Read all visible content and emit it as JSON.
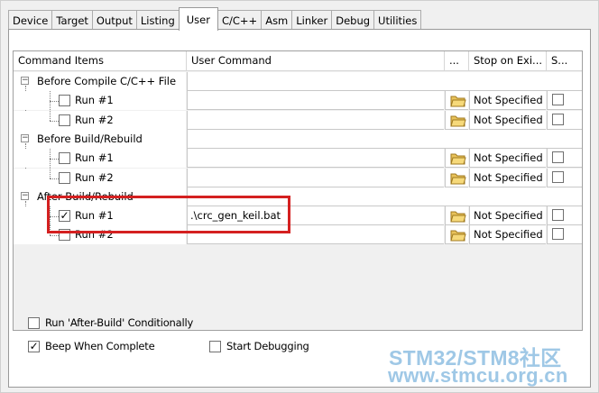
{
  "tabs": [
    {
      "label": "Device"
    },
    {
      "label": "Target"
    },
    {
      "label": "Output"
    },
    {
      "label": "Listing"
    },
    {
      "label": "User",
      "active": true
    },
    {
      "label": "C/C++"
    },
    {
      "label": "Asm"
    },
    {
      "label": "Linker"
    },
    {
      "label": "Debug"
    },
    {
      "label": "Utilities"
    }
  ],
  "grid": {
    "headers": {
      "items": "Command Items",
      "command": "User Command",
      "browse": "...",
      "stop": "Stop on Exi...",
      "s": "S..."
    },
    "groups": [
      {
        "label": "Before Compile C/C++ File",
        "expander": "−",
        "runs": [
          {
            "label": "Run #1",
            "checked": false,
            "command": "",
            "stop": "Not Specified"
          },
          {
            "label": "Run #2",
            "checked": false,
            "command": "",
            "stop": "Not Specified"
          }
        ]
      },
      {
        "label": "Before Build/Rebuild",
        "expander": "−",
        "runs": [
          {
            "label": "Run #1",
            "checked": false,
            "command": "",
            "stop": "Not Specified"
          },
          {
            "label": "Run #2",
            "checked": false,
            "command": "",
            "stop": "Not Specified"
          }
        ]
      },
      {
        "label": "After Build/Rebuild",
        "expander": "−",
        "runs": [
          {
            "label": "Run #1",
            "checked": true,
            "command": ".\\crc_gen_keil.bat",
            "stop": "Not Specified"
          },
          {
            "label": "Run #2",
            "checked": false,
            "command": "",
            "stop": "Not Specified"
          }
        ]
      }
    ]
  },
  "options": {
    "run_after_build": {
      "label": "Run 'After-Build' Conditionally",
      "checked": false
    },
    "beep": {
      "label": "Beep When Complete",
      "checked": true
    },
    "start_debug": {
      "label": "Start Debugging",
      "checked": false
    }
  },
  "check_glyph": "✓",
  "watermark": {
    "line1": "STM32/STM8社区",
    "line2": "www.stmcu.org.cn"
  },
  "colors": {
    "highlight": "#d42020",
    "watermark": "#9fc8e6"
  },
  "icons": {
    "browse": "folder-open-icon",
    "expander": "minus-box-icon"
  }
}
